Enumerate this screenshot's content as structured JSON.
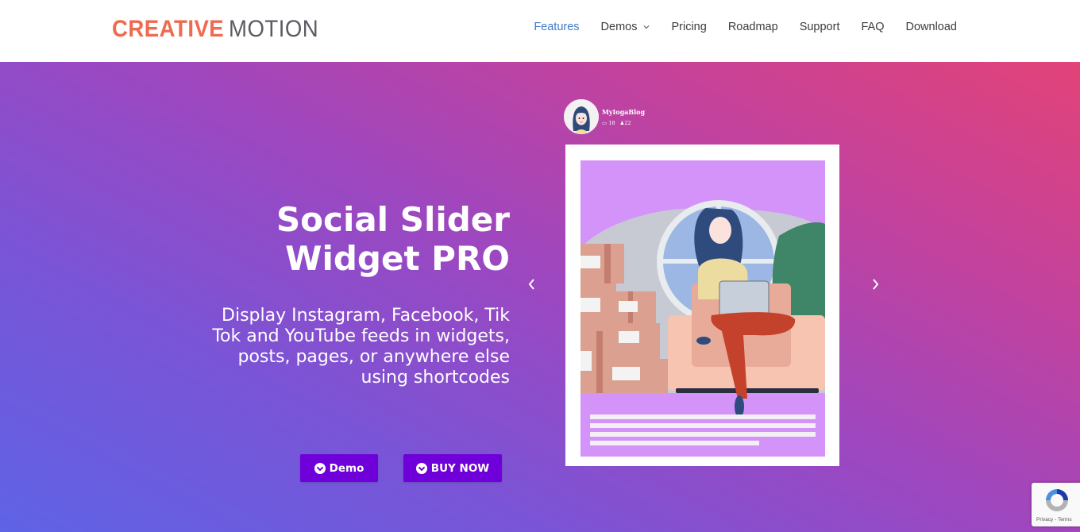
{
  "header": {
    "logo": {
      "part1": "CREATIVE",
      "part2": "MOTION"
    },
    "nav": [
      {
        "label": "Features",
        "active": true
      },
      {
        "label": "Demos",
        "has_dropdown": true
      },
      {
        "label": "Pricing"
      },
      {
        "label": "Roadmap"
      },
      {
        "label": "Support"
      },
      {
        "label": "FAQ"
      },
      {
        "label": "Download"
      }
    ]
  },
  "hero": {
    "title_line1": "Social Slider",
    "title_line2": "Widget PRO",
    "subtitle": "Display Instagram, Facebook, Tik Tok and YouTube feeds in widgets, posts, pages, or anywhere else using shortcodes",
    "buttons": [
      {
        "label": "Demo",
        "icon": "download-circle-icon"
      },
      {
        "label": "BUY NOW",
        "icon": "download-circle-icon"
      }
    ],
    "colors": {
      "gradient_start": "#5f63e6",
      "gradient_end": "#e24378",
      "button": "#7000d9"
    }
  },
  "slider": {
    "profile": {
      "name": "MyIogaBlog",
      "posts": "18",
      "followers": "22"
    },
    "prev_icon": "chevron-left-icon",
    "next_icon": "chevron-right-icon"
  },
  "recaptcha": {
    "label": "Privacy - Terms"
  }
}
